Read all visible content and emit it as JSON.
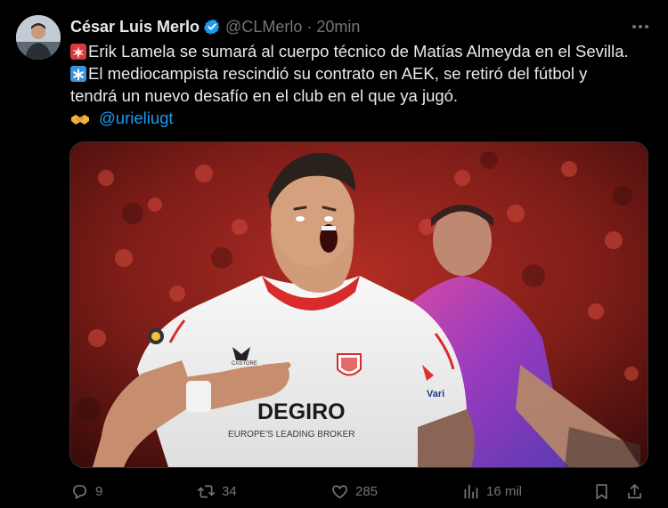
{
  "author": {
    "name": "César Luis Merlo",
    "handle": "@CLMerlo",
    "separator": "·",
    "time": "20min"
  },
  "tweet": {
    "line1": "Erik Lamela se sumará al cuerpo técnico de Matías Almeyda en el Sevilla.",
    "line2": "El mediocampista rescindió su contrato en AEK, se retiró del fútbol y",
    "line3": "tendrá un nuevo desafío en el club en el que ya jugó.",
    "mention": "@urieliugt"
  },
  "media": {
    "sponsor": "DEGIRO",
    "sponsor_tagline": "EUROPE'S LEADING BROKER",
    "kit_brand": "CASTORE",
    "sleeve_text": "Vari"
  },
  "actions": {
    "replies": "9",
    "reposts": "34",
    "likes": "285",
    "views": "16 mil"
  },
  "colors": {
    "background": "#000000",
    "text": "#e7e9ea",
    "muted": "#71767b",
    "accent": "#1d9bf0"
  },
  "icons": [
    "verified-icon",
    "more-icon",
    "siren-icon",
    "asterisk-icon",
    "handshake-icon",
    "reply-icon",
    "repost-icon",
    "like-icon",
    "views-icon",
    "bookmark-icon",
    "share-icon"
  ]
}
